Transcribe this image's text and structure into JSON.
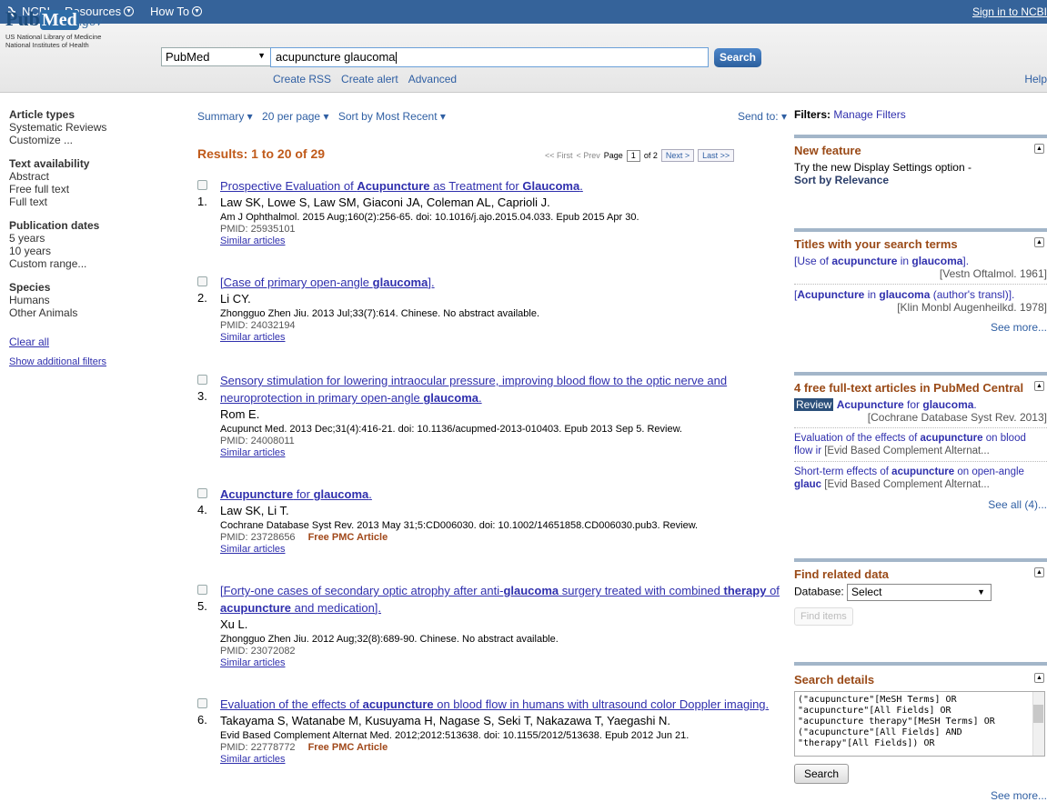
{
  "topbar": {
    "brand": "NCBI",
    "menus": [
      "Resources",
      "How To"
    ],
    "signin": "Sign in to NCBI"
  },
  "header": {
    "logo_pub": "Pub",
    "logo_med": "Med",
    "logo_gov": ".gov",
    "logo_sub1": "US National Library of Medicine",
    "logo_sub2": "National Institutes of Health",
    "database": "PubMed",
    "query": "acupuncture glaucoma",
    "search_label": "Search",
    "links": [
      "Create RSS",
      "Create alert",
      "Advanced"
    ],
    "help": "Help"
  },
  "left": {
    "groups": [
      {
        "title": "Article types",
        "items": [
          "Systematic Reviews",
          "Customize ..."
        ]
      },
      {
        "title": "Text availability",
        "items": [
          "Abstract",
          "Free full text",
          "Full text"
        ]
      },
      {
        "title": "Publication dates",
        "items": [
          "5 years",
          "10 years",
          "Custom range..."
        ]
      },
      {
        "title": "Species",
        "items": [
          "Humans",
          "Other Animals"
        ]
      }
    ],
    "clear_all": "Clear all",
    "show_filters": "Show additional filters"
  },
  "toolbar": {
    "format": "Summary",
    "per_page": "20 per page",
    "sort": "Sort by Most Recent",
    "send_to": "Send to:"
  },
  "results_heading": "Results: 1 to 20 of 29",
  "pager": {
    "first": "<< First",
    "prev": "< Prev",
    "page_label": "Page",
    "page": "1",
    "of": "of 2",
    "next": "Next >",
    "last": "Last >>"
  },
  "results": [
    {
      "num": "1.",
      "title_html": "Prospective Evaluation of <span class='hl'>Acupuncture</span> as Treatment for <span class='hl'>Glaucoma</span>.",
      "authors": "Law SK, Lowe S, Law SM, Giaconi JA, Coleman AL, Caprioli J.",
      "cite": "Am J Ophthalmol. 2015 Aug;160(2):256-65. doi: 10.1016/j.ajo.2015.04.033. Epub 2015 Apr 30.",
      "pmid": "PMID: 25935101",
      "free": "",
      "similar": "Similar articles"
    },
    {
      "num": "2.",
      "title_html": "[Case of primary open-angle <span class='hl'>glaucoma</span>].",
      "authors": "Li CY.",
      "cite": "Zhongguo Zhen Jiu. 2013 Jul;33(7):614. Chinese. No abstract available.",
      "pmid": "PMID: 24032194",
      "free": "",
      "similar": "Similar articles"
    },
    {
      "num": "3.",
      "title_html": "Sensory stimulation for lowering intraocular pressure, improving blood flow to the optic nerve and neuroprotection in primary open-angle <span class='hl'>glaucoma</span>.",
      "authors": "Rom E.",
      "cite": "Acupunct Med. 2013 Dec;31(4):416-21. doi: 10.1136/acupmed-2013-010403. Epub 2013 Sep 5. Review.",
      "pmid": "PMID: 24008011",
      "free": "",
      "similar": "Similar articles"
    },
    {
      "num": "4.",
      "title_html": "<span class='hl'>Acupuncture</span> for <span class='hl'>glaucoma</span>.",
      "authors": "Law SK, Li T.",
      "cite": "Cochrane Database Syst Rev. 2013 May 31;5:CD006030. doi: 10.1002/14651858.CD006030.pub3. Review.",
      "pmid": "PMID: 23728656",
      "free": "Free PMC Article",
      "similar": "Similar articles"
    },
    {
      "num": "5.",
      "title_html": "[Forty-one cases of secondary optic atrophy after anti-<span class='hl'>glaucoma</span> surgery treated with combined <span class='hl'>therapy</span> of <span class='hl'>acupuncture</span> and medication].",
      "authors": "Xu L.",
      "cite": "Zhongguo Zhen Jiu. 2012 Aug;32(8):689-90. Chinese. No abstract available.",
      "pmid": "PMID: 23072082",
      "free": "",
      "similar": "Similar articles"
    },
    {
      "num": "6.",
      "title_html": "Evaluation of the effects of <span class='hl'>acupuncture</span> on blood flow in humans with ultrasound color Doppler imaging.",
      "authors": "Takayama S, Watanabe M, Kusuyama H, Nagase S, Seki T, Nakazawa T, Yaegashi N.",
      "cite": "Evid Based Complement Alternat Med. 2012;2012:513638. doi: 10.1155/2012/513638. Epub 2012 Jun 21.",
      "pmid": "PMID: 22778772",
      "free": "Free PMC Article",
      "similar": "Similar articles"
    }
  ],
  "right": {
    "filters_label": "Filters:",
    "manage_filters": "Manage Filters",
    "new_feature": {
      "title": "New feature",
      "text": "Try the new Display Settings option -",
      "link": "Sort by Relevance"
    },
    "titles": {
      "title": "Titles with your search terms",
      "items": [
        {
          "html": "[Use of <span class='hl'>acupuncture</span> in <span class='hl'>glaucoma</span>].",
          "journal": "[Vestn Oftalmol. 1961]"
        },
        {
          "html": "[<span class='hl'>Acupuncture</span> in <span class='hl'>glaucoma</span> (author's transl)].",
          "journal": "[Klin Monbl Augenheilkd. 1978]"
        }
      ],
      "see_more": "See more..."
    },
    "pmc": {
      "title": "4 free full-text articles in PubMed Central",
      "review": "Review",
      "item1_html": "<span class='hl'>Acupuncture</span> for <span class='hl'>glaucoma</span>.",
      "item1_journal": "[Cochrane Database Syst Rev. 2013]",
      "item2_html": "Evaluation of the effects of <span class='hl'>acupuncture</span> on blood flow ir <span style='color:#555'>[Evid Based Complement Alternat...</span>",
      "item3_html": "Short-term effects of <span class='hl'>acupuncture</span> on open-angle <span class='hl'>glauc</span> <span style='color:#555'>[Evid Based Complement Alternat...</span>",
      "see_all": "See all (4)..."
    },
    "related": {
      "title": "Find related data",
      "db_label": "Database:",
      "db_value": "Select",
      "find_items": "Find items"
    },
    "details": {
      "title": "Search details",
      "query_text": "(\"acupuncture\"[MeSH Terms] OR\n\"acupuncture\"[All Fields] OR\n\"acupuncture therapy\"[MeSH Terms] OR\n(\"acupuncture\"[All Fields] AND\n\"therapy\"[All Fields]) OR",
      "search_label": "Search",
      "see_more": "See more..."
    }
  },
  "colors": {
    "topbar": "#35639a",
    "link": "#2f2fad",
    "results_heading": "#c05a1a",
    "portlet_title": "#9a4a17"
  }
}
